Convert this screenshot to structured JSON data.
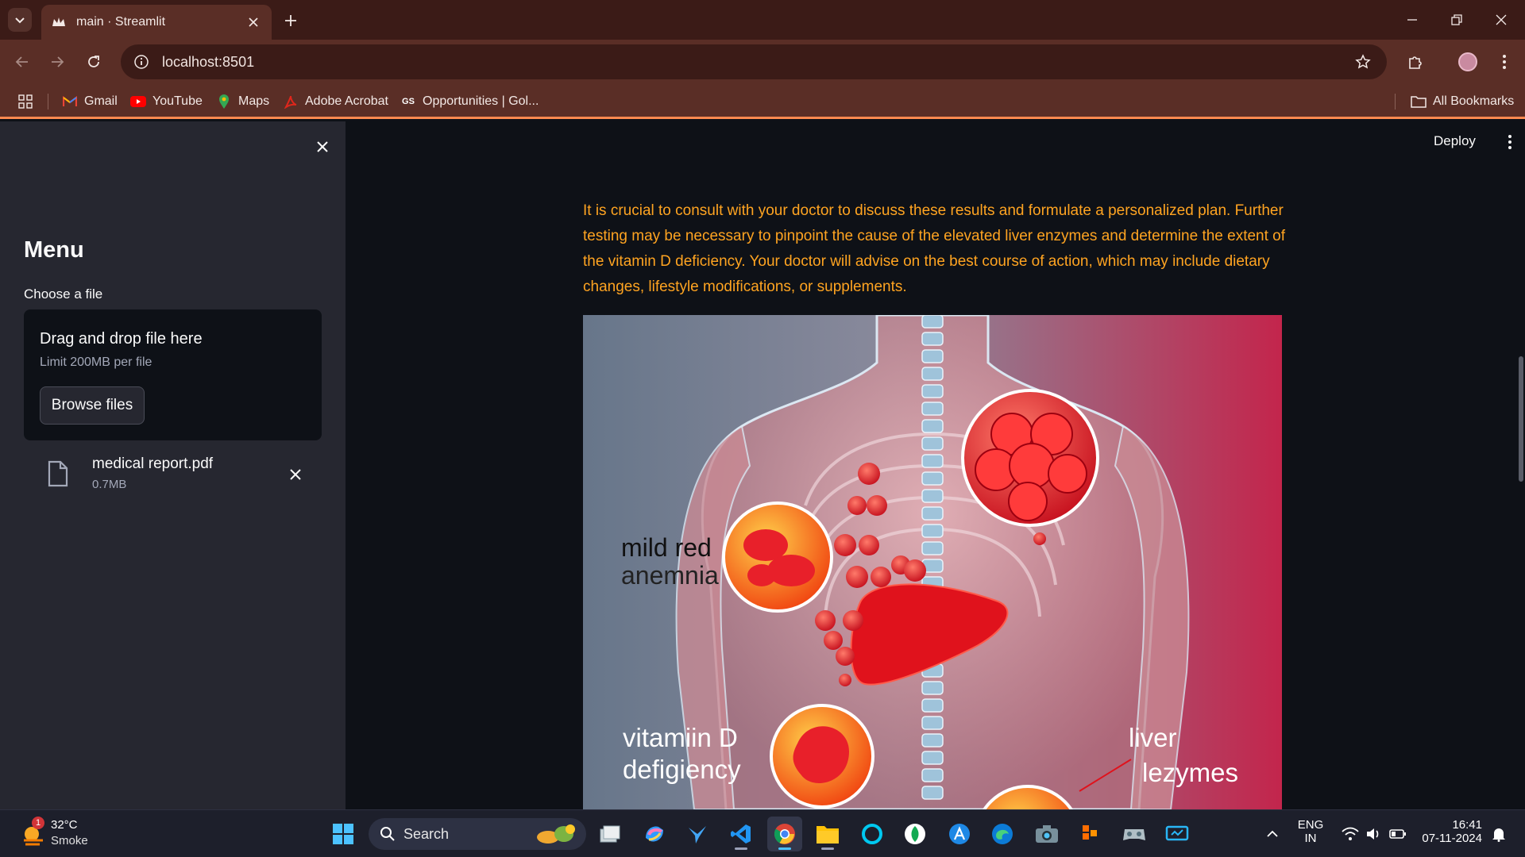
{
  "browser": {
    "tab_title": "main · Streamlit",
    "url": "localhost:8501",
    "bookmarks": [
      {
        "label": "Gmail",
        "icon": "gmail-icon"
      },
      {
        "label": "YouTube",
        "icon": "youtube-icon"
      },
      {
        "label": "Maps",
        "icon": "maps-icon"
      },
      {
        "label": "Adobe Acrobat",
        "icon": "acrobat-icon"
      },
      {
        "label": "Opportunities | Gol...",
        "icon": "gs-icon"
      }
    ],
    "all_bookmarks": "All Bookmarks"
  },
  "sidebar": {
    "title": "Menu",
    "uploader_label": "Choose a file",
    "dropzone_title": "Drag and drop file here",
    "dropzone_limit": "Limit 200MB per file",
    "browse_label": "Browse files",
    "file": {
      "name": "medical report.pdf",
      "size": "0.7MB"
    }
  },
  "main": {
    "deploy_label": "Deploy",
    "paragraph": "It is crucial to consult with your doctor to discuss these results and formulate a personalized plan. Further testing may be necessary to pinpoint the cause of the elevated liver enzymes and determine the extent of the vitamin D deficiency. Your doctor will advise on the best course of action, which may include dietary changes, lifestyle modifications, or supplements.",
    "figure_labels": {
      "anemia_line1": "mild red",
      "anemia_line2": "anemnia",
      "vitd_line1": "vitamiin D",
      "vitd_line2": "defigiency",
      "liver_line1": "liver",
      "liver_line2": "lezymes"
    }
  },
  "taskbar": {
    "weather_temp": "32°C",
    "weather_desc": "Smoke",
    "weather_badge": "1",
    "search_label": "Search",
    "lang_line1": "ENG",
    "lang_line2": "IN",
    "time": "16:41",
    "date": "07-11-2024"
  },
  "colors": {
    "accent_text": "#ffa421",
    "sidebar_bg": "#262730",
    "main_bg": "#0e1117",
    "browser_frame": "#5a2e26"
  }
}
